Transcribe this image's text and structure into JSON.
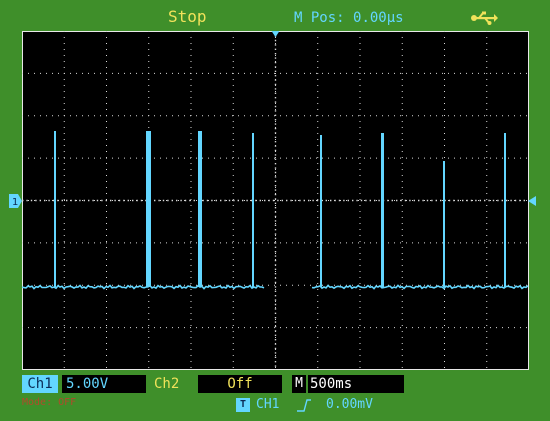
{
  "status": {
    "run_state": "Stop"
  },
  "header": {
    "m_pos_label": "M Pos:",
    "m_pos_value": "0.00µs"
  },
  "channels": {
    "ch1_label": "Ch1",
    "ch1_scale": "5.00V",
    "ch2_label": "Ch2",
    "ch2_scale": "Off"
  },
  "timebase": {
    "label": "M",
    "value": "500ms"
  },
  "trigger": {
    "badge": "T",
    "source": "CH1",
    "level": "0.00mV"
  },
  "mode": {
    "label": "Mode: OFF"
  },
  "colors": {
    "bezel": "#3f8f2a",
    "ch1": "#63d6ff",
    "ch2": "#f0e25a",
    "grid": "#d8d8d8",
    "screen": "#000000"
  },
  "icons": {
    "usb": "usb-icon",
    "ch1_marker": "channel-marker-icon",
    "trigger_marker": "trigger-marker-icon",
    "edge": "rising-edge-icon"
  }
}
